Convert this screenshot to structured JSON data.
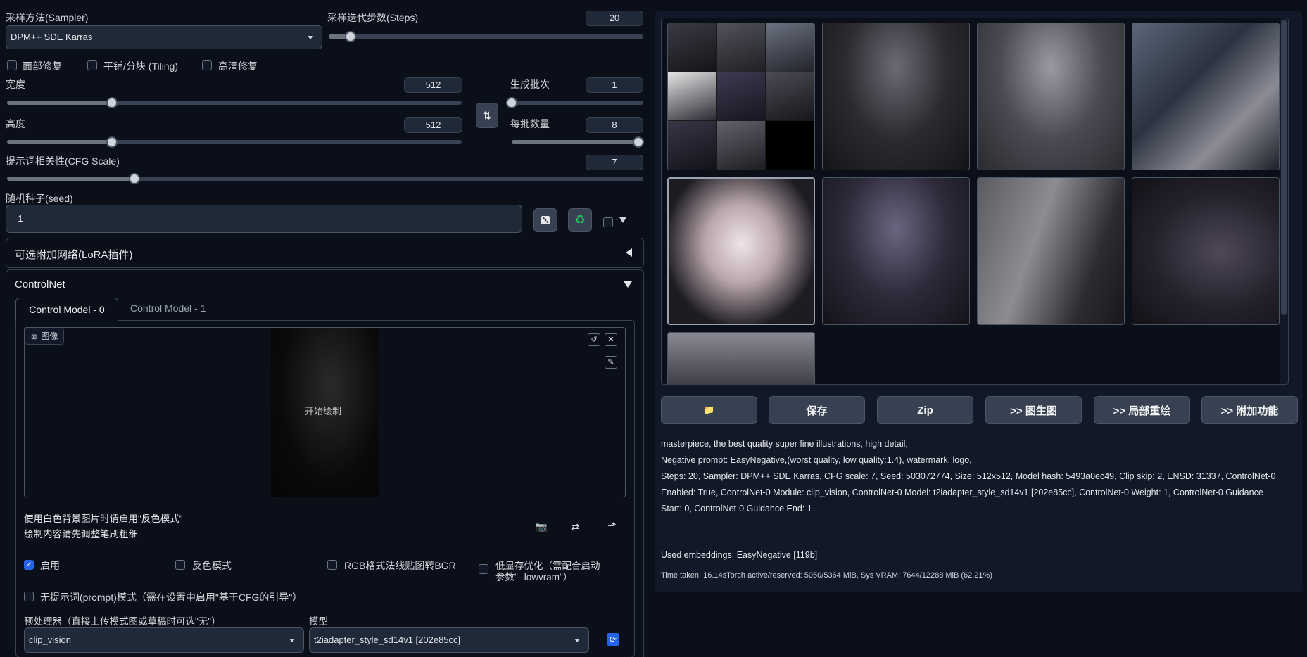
{
  "sampler": {
    "label": "采样方法(Sampler)",
    "value": "DPM++ SDE Karras"
  },
  "steps": {
    "label": "采样迭代步数(Steps)",
    "value": "20",
    "fraction": 0.07
  },
  "options": {
    "face_restore": "面部修复",
    "tiling": "平铺/分块 (Tiling)",
    "hires": "高清修复"
  },
  "width": {
    "label": "宽度",
    "value": "512",
    "fraction": 0.23
  },
  "height": {
    "label": "高度",
    "value": "512",
    "fraction": 0.23
  },
  "batch_count": {
    "label": "生成批次",
    "value": "1",
    "fraction": 0.0
  },
  "batch_size": {
    "label": "每批数量",
    "value": "8",
    "fraction": 1.0
  },
  "cfg": {
    "label": "提示词相关性(CFG Scale)",
    "value": "7",
    "fraction": 0.2
  },
  "seed": {
    "label": "随机种子(seed)",
    "value": "-1"
  },
  "lora": {
    "title": "可选附加网络(LoRA插件)"
  },
  "controlnet": {
    "title": "ControlNet",
    "tabs": [
      "Control Model - 0",
      "Control Model - 1"
    ],
    "image_label": "图像",
    "canvas_text": "开始绘制",
    "hint1": "使用白色背景图片时请启用\"反色模式\"",
    "hint2": "绘制内容请先调整笔刷粗细",
    "enable": "启用",
    "invert": "反色模式",
    "rgb_bgr": "RGB格式法线贴图转BGR",
    "lowvram_1": "低显存优化（需配合启动",
    "lowvram_2": "参数\"--lowvram\"）",
    "guess_mode": "无提示词(prompt)模式（需在设置中启用\"基于CFG的引导\"）",
    "preprocessor_label": "预处理器（直接上传模式图或草稿时可选\"无\"）",
    "preprocessor_value": "clip_vision",
    "model_label": "模型",
    "model_value": "t2iadapter_style_sd14v1 [202e85cc]"
  },
  "buttons": {
    "folder": "📁",
    "save": "保存",
    "zip": "Zip",
    "img2img": ">> 图生图",
    "inpaint": ">> 局部重绘",
    "extras": ">> 附加功能"
  },
  "output": {
    "line1": "masterpiece, the best quality super fine illustrations, high detail,",
    "line2": "Negative prompt: EasyNegative,(worst quality, low quality:1.4), watermark, logo,",
    "line3": "Steps: 20, Sampler: DPM++ SDE Karras, CFG scale: 7, Seed: 503072774, Size: 512x512, Model hash: 5493a0ec49, Clip skip: 2, ENSD: 31337, ControlNet-0",
    "line4": "Enabled: True, ControlNet-0 Module: clip_vision, ControlNet-0 Model: t2iadapter_style_sd14v1 [202e85cc], ControlNet-0 Weight: 1, ControlNet-0 Guidance",
    "line5": "Start: 0, ControlNet-0 Guidance End: 1",
    "embeddings": "Used embeddings: EasyNegative [119b]",
    "time": "Time taken: 16.14sTorch active/reserved: 5050/5364 MiB, Sys VRAM: 7644/12288 MiB (62.21%)"
  },
  "colors": {
    "background": "#0b0f19",
    "accent": "#2563eb",
    "recycle": "#22c55e"
  }
}
